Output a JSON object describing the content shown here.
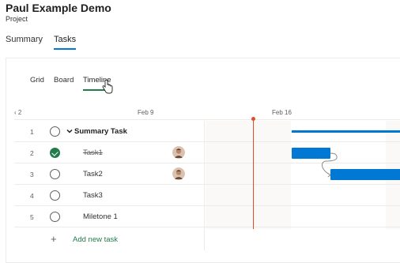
{
  "project": {
    "title": "Paul Example Demo",
    "subtitle": "Project"
  },
  "top_tabs": [
    {
      "label": "Summary"
    },
    {
      "label": "Tasks",
      "active": true
    }
  ],
  "view_tabs": [
    {
      "label": "Grid"
    },
    {
      "label": "Board"
    },
    {
      "label": "Timeline",
      "active": true
    }
  ],
  "timeline": {
    "dates": [
      "2",
      "Feb 9",
      "Feb 16"
    ]
  },
  "tasks": [
    {
      "num": "1",
      "name": "Summary Task",
      "summary": true,
      "done": false
    },
    {
      "num": "2",
      "name": "Task1",
      "done": true,
      "assigned": true
    },
    {
      "num": "3",
      "name": "Task2",
      "done": false,
      "assigned": true
    },
    {
      "num": "4",
      "name": "Task3",
      "done": false
    },
    {
      "num": "5",
      "name": "Miletone 1",
      "done": false
    }
  ],
  "add_task": {
    "label": "Add new task"
  },
  "colors": {
    "accent": "#0078d4",
    "green": "#237b4b",
    "today": "#e04c2b"
  }
}
